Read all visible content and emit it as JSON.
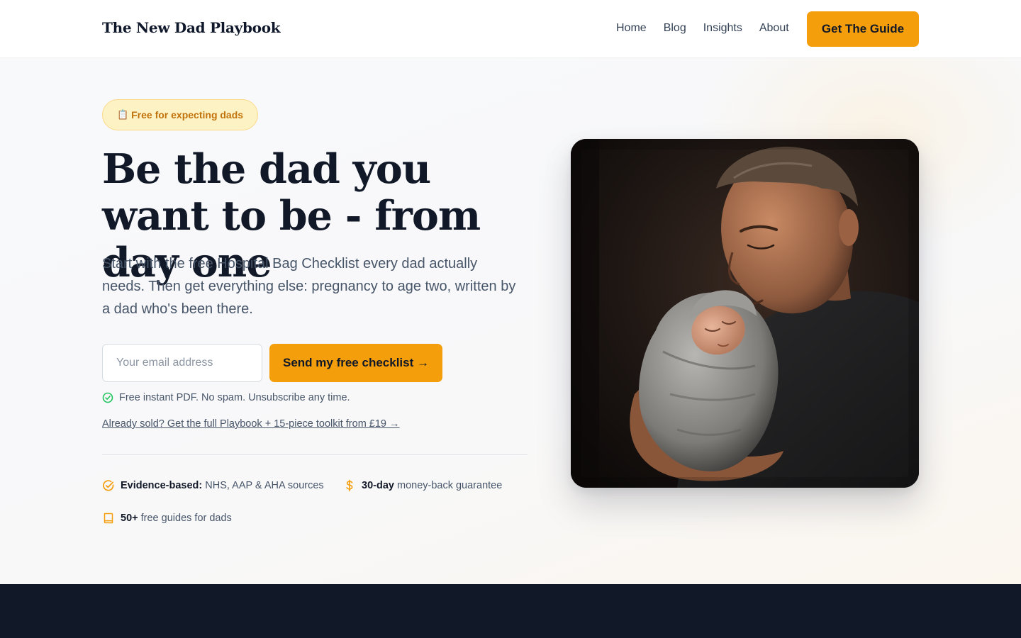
{
  "nav": {
    "brand": "The New Dad Playbook",
    "links": [
      "Home",
      "Blog",
      "Insights",
      "About"
    ],
    "cta": "Get The Guide"
  },
  "hero": {
    "badge": "Free for expecting dads",
    "badge_icon": "clipboard-icon",
    "headline": "Be the dad you want to be - from day one",
    "subcopy": "Start with the free Hospital Bag Checklist every dad actually needs. Then get everything else: pregnancy to age two, written by a dad who's been there.",
    "email_placeholder": "Your email address",
    "submit_label": "Send my free checklist →",
    "note": "Free instant PDF. No spam. Unsubscribe any time.",
    "upsell": "Already sold? Get the full Playbook + 15-piece toolkit from £19 →",
    "trust": [
      {
        "icon": "check-circle-icon",
        "strong": "Evidence-based:",
        "text": "NHS, AAP & AHA sources"
      },
      {
        "icon": "dollar-icon",
        "strong": "30-day",
        "text": "money-back guarantee"
      },
      {
        "icon": "book-icon",
        "strong": "50+",
        "text": "free guides for dads"
      }
    ]
  },
  "colors": {
    "accent": "#f59e0b",
    "navy": "#111827",
    "badge_bg": "#fdf2c4",
    "success": "#22c55e"
  }
}
